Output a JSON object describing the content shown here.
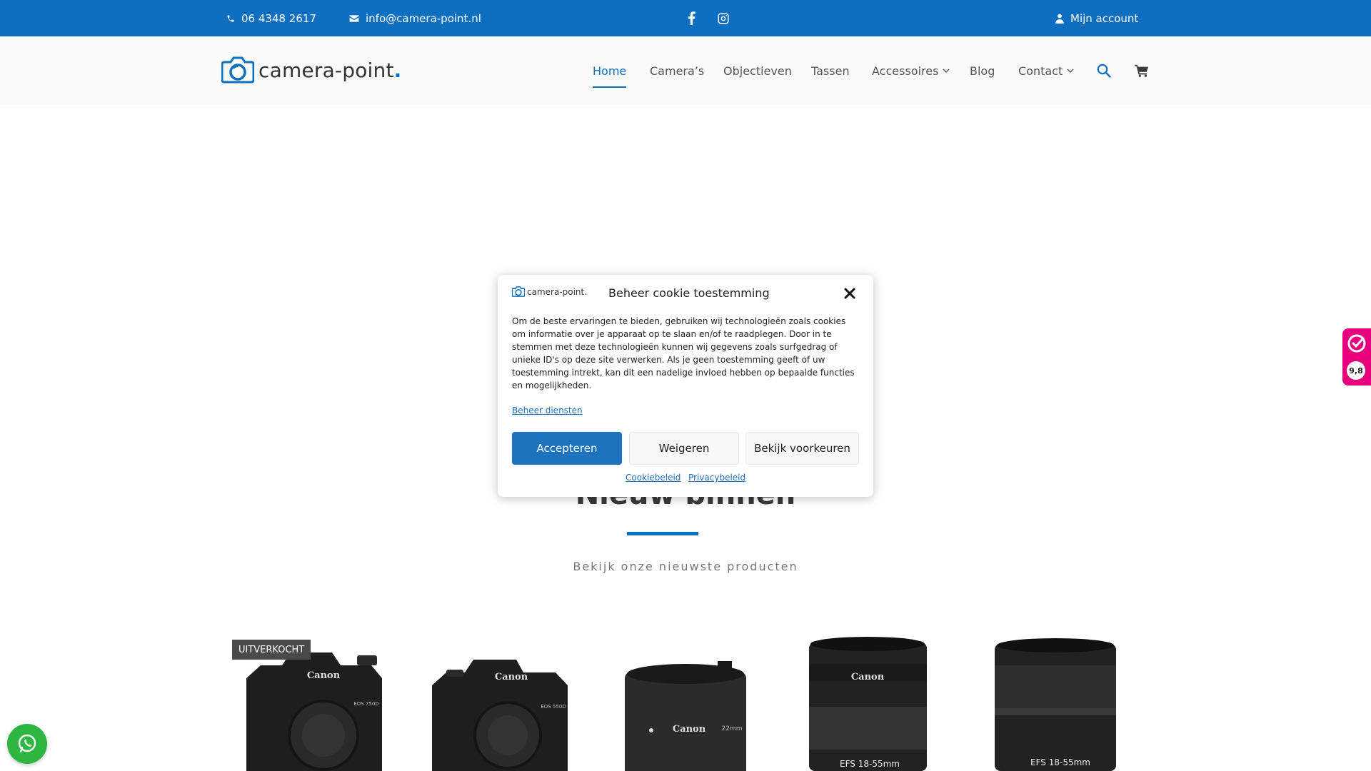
{
  "topbar": {
    "phone": "06 4348 2617",
    "email": "info@camera-point.nl",
    "account": "Mijn account"
  },
  "header": {
    "logo_text": "camera-point",
    "logo_dot": "."
  },
  "nav": {
    "items": [
      {
        "label": "Home"
      },
      {
        "label": "Camera’s"
      },
      {
        "label": "Objectieven"
      },
      {
        "label": "Tassen"
      },
      {
        "label": "Accessoires"
      },
      {
        "label": "Blog"
      },
      {
        "label": "Contact"
      }
    ]
  },
  "section": {
    "title": "Nieuw binnen",
    "subtitle": "Bekijk onze nieuwste producten"
  },
  "products": {
    "badge": "UITVERKOCHT",
    "brand": "Canon",
    "labels": [
      "EOS 750D",
      "EOS 550D",
      "22mm",
      "EFS 18-55mm",
      "EFS 18-55mm"
    ]
  },
  "cookie": {
    "logo_text": "camera-point.",
    "title": "Beheer cookie toestemming",
    "body": "Om de beste ervaringen te bieden, gebruiken wij technologieën zoals cookies om informatie over je apparaat op te slaan en/of te raadplegen. Door in te stemmen met deze technologieën kunnen wij gegevens zoals surfgedrag of unieke ID's op deze site verwerken. Als je geen toestemming geeft of uw toestemming intrekt, kan dit een nadelige invloed hebben op bepaalde functies en mogelijkheden.",
    "manage_link": "Beheer diensten",
    "accept": "Accepteren",
    "deny": "Weigeren",
    "prefs": "Bekijk voorkeuren",
    "cookie_policy": "Cookiebeleid",
    "privacy_policy": "Privacybeleid"
  },
  "kiyoh": {
    "score": "9,8"
  },
  "colors": {
    "brand_blue": "#0d6fc0",
    "kiyoh_pink": "#e6007e",
    "whatsapp_green": "#2db742"
  }
}
